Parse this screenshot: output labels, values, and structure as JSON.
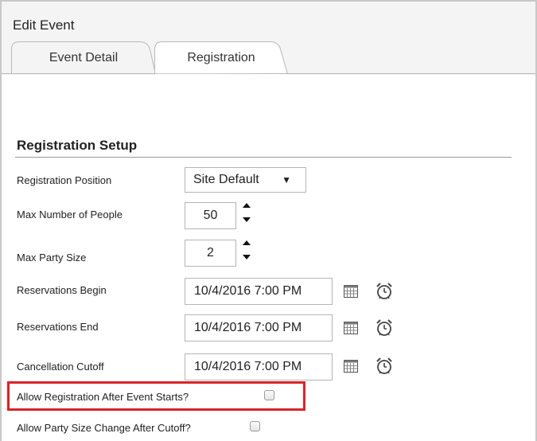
{
  "window": {
    "title": "Edit Event"
  },
  "tabs": [
    {
      "label": "Event Detail",
      "active": false
    },
    {
      "label": "Registration",
      "active": true
    }
  ],
  "section": {
    "title": "Registration Setup"
  },
  "fields": {
    "registration_position": {
      "label": "Registration Position",
      "value": "Site Default",
      "caret": "▼"
    },
    "max_people": {
      "label": "Max Number of People",
      "value": "50"
    },
    "max_party": {
      "label": "Max Party Size",
      "value": "2"
    },
    "reservations_begin": {
      "label": "Reservations Begin",
      "value": "10/4/2016 7:00 PM"
    },
    "reservations_end": {
      "label": "Reservations End",
      "value": "10/4/2016 7:00 PM"
    },
    "cancellation_cutoff": {
      "label": "Cancellation Cutoff",
      "value": "10/4/2016 7:00 PM"
    }
  },
  "checkboxes": {
    "allow_after_start": {
      "label": "Allow Registration After Event Starts?",
      "checked": false
    },
    "allow_party_change": {
      "label": "Allow Party Size Change After Cutoff?",
      "checked": false
    }
  },
  "colors": {
    "highlight": "#d8232a",
    "tab_background": "#f4f4f4"
  }
}
